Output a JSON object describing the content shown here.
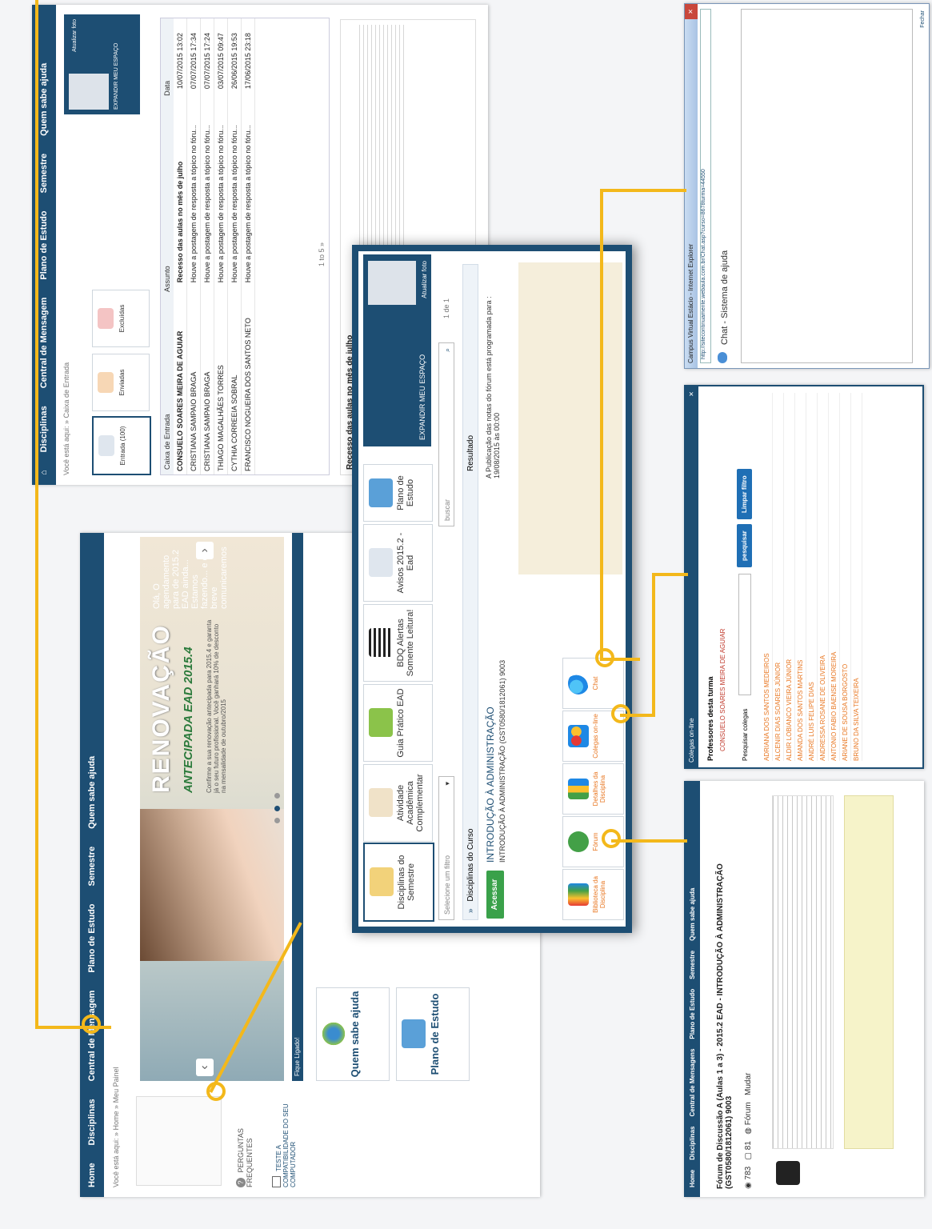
{
  "portal": {
    "nav": [
      "Home",
      "Disciplinas",
      "Central de Mensagem",
      "Plano de Estudo",
      "Semestre",
      "Quem sabe ajuda"
    ],
    "breadcrumb": "Você está aqui: » Home » Meu Painel",
    "banner_title": "RENOVAÇÃO",
    "banner_subtitle": "ANTECIPADA EAD 2015.4",
    "banner_text": "Confirme a sua renovação antecipada para 2015.4 e garanta já o seu futuro profissional. Você ganhará 10% de desconto na mensalidade de outubro/2015",
    "banner_side": "Olá, O agendamento para de 2015.2 EAD ainda... Estamos fazendo... e em breve comunicaremos",
    "faq": "PERGUNTAS FREQUENTES",
    "test": "TESTE A COMPATIBILIDADE DO SEU COMPUTADOR",
    "quick_links": "Fique Ligado!",
    "bottom_tiles": [
      "Quem sabe ajuda",
      "Plano de Estudo"
    ]
  },
  "messages": {
    "nav": [
      "Disciplinas",
      "Central de Mensagem",
      "Plano de Estudo",
      "Semestre",
      "Quem sabe ajuda"
    ],
    "breadcrumb": "Você está aqui: » Caixa de Entrada",
    "boxes": [
      "Entrada (100)",
      "Enviadas",
      "Excluídas"
    ],
    "inbox_label": "Caixa de Entrada",
    "col_subject": "Assunto",
    "col_date": "Data",
    "rows": [
      {
        "from": "CONSUELO SOARES MEIRA DE AGUIAR",
        "subject": "Recesso das aulas no mês de julho",
        "date": "10/07/2015 13:02"
      },
      {
        "from": "CRISTIANA SAMPAIO BRAGA",
        "subject": "Houve a postagem de resposta a tópico no fóru...",
        "date": "07/07/2015 17:34"
      },
      {
        "from": "CRISTIANA SAMPAIO BRAGA",
        "subject": "Houve a postagem de resposta a tópico no fóru...",
        "date": "07/07/2015 17:24"
      },
      {
        "from": "THIAGO MAGALHÃES TORRES",
        "subject": "Houve a postagem de resposta a tópico no fóru...",
        "date": "03/07/2015 09:47"
      },
      {
        "from": "CYTHIA CORREEIA SOBRAL",
        "subject": "Houve a postagem de resposta a tópico no fóru...",
        "date": "26/06/2015 19:53"
      },
      {
        "from": "FRANCISCO NOGUEIRA DOS SANTOS NETO",
        "subject": "Houve a postagem de resposta a tópico no fóru...",
        "date": "17/06/2015 23:18"
      }
    ],
    "pager": "1 to 5 »",
    "preview_title": "Recesso das aulas no mês de julho",
    "expand": "EXPANDIR MEU ESPAÇO",
    "update_photo": "Atualizar foto"
  },
  "center": {
    "tiles": [
      "Disciplinas do Semestre",
      "Atividade Acadêmica Complementar",
      "Guia Prático EAD",
      "BDQ Alertas Somente Leitura!",
      "Avisos 2015.2 - Ead",
      "Plano de Estudo"
    ],
    "filter_placeholder": "Selecione um filtro",
    "search_placeholder": "buscar",
    "pager": "1 de 1",
    "expand": "EXPANDIR MEU ESPAÇO",
    "update_photo": "Atualizar foto",
    "section_title": "Disciplinas do Curso",
    "result_header": "Resultado",
    "course_title": "INTRODUÇÃO À ADMINISTRAÇÃO",
    "course_code": "INTRODUÇÃO À ADMINISTRAÇÃO (GST0580/1812061) 9003",
    "access_button": "Acessar",
    "result_text": "A Publicação das notas do fórum está programada para : 19/08/2015 às 00:00",
    "tools": [
      "Biblioteca da Disciplina",
      "Fórum",
      "Detalhes da Disciplina",
      "Colegas on-line",
      "Chat"
    ]
  },
  "forum": {
    "title": "Fórum de Discussão A (Aulas 1 a 3) - 2015.2 EAD - INTRODUÇÃO À ADMINISTRAÇÃO (GST0580/1812061) 9003",
    "stats": [
      "783",
      "81",
      "Fórum",
      "Mudar"
    ],
    "nav": [
      "Home",
      "Disciplinas",
      "Central de Mensagens",
      "Plano de Estudo",
      "Semestre",
      "Quem sabe ajuda"
    ]
  },
  "colleagues": {
    "title": "Colegas on-line",
    "teachers_label": "Professores desta turma",
    "teacher": "CONSUELO SOARES MEIRA DE AGUIAR",
    "search_label": "Pesquisar colegas",
    "search_button": "pesquisar",
    "clear_button": "Limpar filtro",
    "students": [
      "ADRIANA DOS SANTOS MEDEIROS",
      "ALCENIR DIAS SOARES JÚNIOR",
      "ALDIR LOBIANCO VIEIRA JÚNIOR",
      "AMANDA DOS SANTOS MARTINS",
      "ANDRÉ LUIS FELIPE DIAS",
      "ANDRESSA ROSANE DE OLIVEIRA",
      "ANTONIO FABIO BAENSE MOREIRA",
      "ARIANE DE SOUSA BORGOSTO",
      "BRUNO DA SILVA TEIXEIRA"
    ]
  },
  "chat": {
    "window_title": "Campus Virtual Estácio - Internet Explorer",
    "url": "http://sitecontinuamente.webaula.com.br/Chat.asp?curso=8678turma=44550",
    "header": "Chat - Sistema de ajuda",
    "close_label": "Fechar"
  }
}
